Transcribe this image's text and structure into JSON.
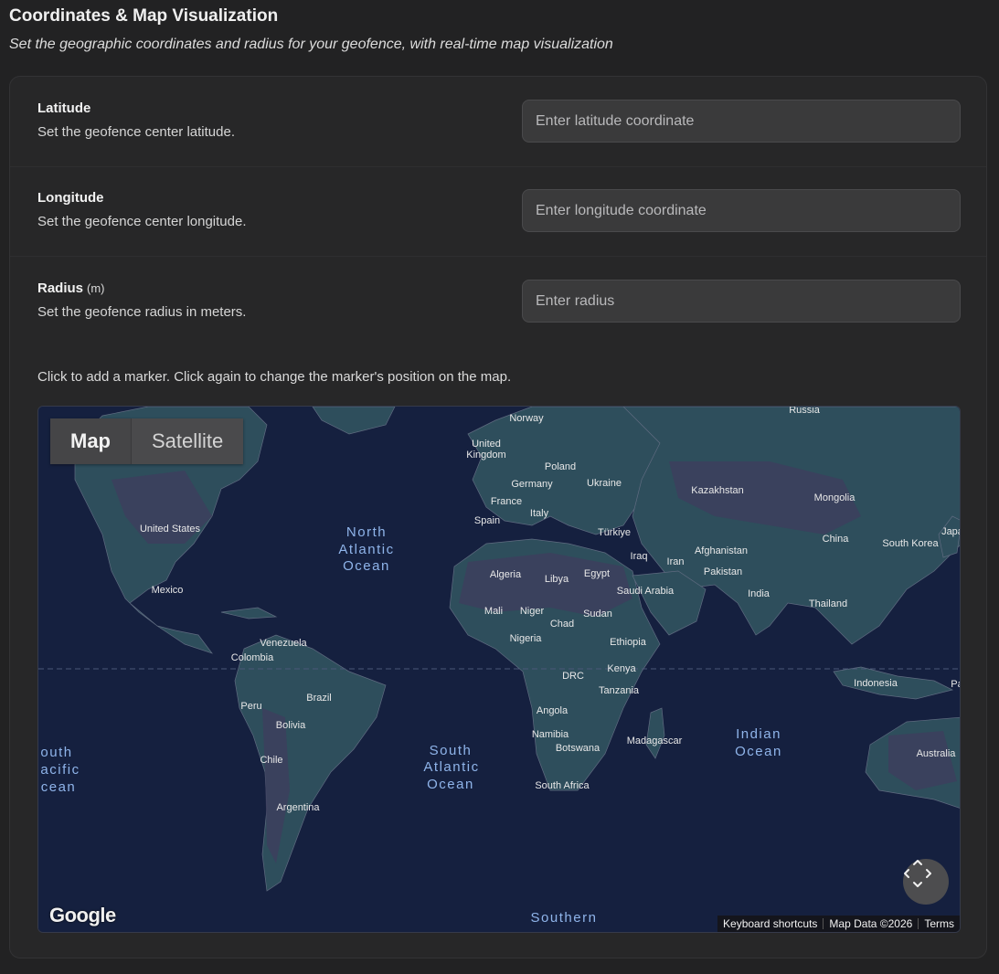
{
  "section": {
    "title": "Coordinates & Map Visualization",
    "subtitle": "Set the geographic coordinates and radius for your geofence, with real-time map visualization"
  },
  "fields": {
    "latitude": {
      "label": "Latitude",
      "description": "Set the geofence center latitude.",
      "placeholder": "Enter latitude coordinate",
      "value": ""
    },
    "longitude": {
      "label": "Longitude",
      "description": "Set the geofence center longitude.",
      "placeholder": "Enter longitude coordinate",
      "value": ""
    },
    "radius": {
      "label": "Radius",
      "unit": "(m)",
      "description": "Set the geofence radius in meters.",
      "placeholder": "Enter radius",
      "value": ""
    }
  },
  "map": {
    "hint": "Click to add a marker. Click again to change the marker's position on the map.",
    "type_buttons": {
      "map": "Map",
      "satellite": "Satellite",
      "selected": "Map"
    },
    "logo": "Google",
    "attribution": {
      "shortcuts": "Keyboard shortcuts",
      "data": "Map Data ©2026",
      "terms": "Terms"
    },
    "oceans": {
      "north_atlantic": [
        "North",
        "Atlantic",
        "Ocean"
      ],
      "south_atlantic": [
        "South",
        "Atlantic",
        "Ocean"
      ],
      "indian": [
        "Indian",
        "Ocean"
      ],
      "south_pacific": [
        "outh",
        "acific",
        "cean"
      ],
      "southern": "Southern"
    },
    "countries": {
      "russia": "Russia",
      "norway": "Norway",
      "uk": "United Kingdom",
      "poland": "Poland",
      "germany": "Germany",
      "ukraine": "Ukraine",
      "france": "France",
      "spain": "Spain",
      "italy": "Italy",
      "turkiye": "Türkiye",
      "kazakhstan": "Kazakhstan",
      "mongolia": "Mongolia",
      "china": "China",
      "japan": "Japa",
      "south_korea": "South Korea",
      "afghanistan": "Afghanistan",
      "iraq": "Iraq",
      "iran": "Iran",
      "pakistan": "Pakistan",
      "india": "India",
      "thailand": "Thailand",
      "saudi_arabia": "Saudi Arabia",
      "egypt": "Egypt",
      "libya": "Libya",
      "algeria": "Algeria",
      "mali": "Mali",
      "niger": "Niger",
      "chad": "Chad",
      "sudan": "Sudan",
      "nigeria": "Nigeria",
      "ethiopia": "Ethiopia",
      "kenya": "Kenya",
      "drc": "DRC",
      "tanzania": "Tanzania",
      "angola": "Angola",
      "namibia": "Namibia",
      "botswana": "Botswana",
      "madagascar": "Madagascar",
      "south_africa": "South Africa",
      "indonesia": "Indonesia",
      "australia": "Australia",
      "united_states": "United States",
      "mexico": "Mexico",
      "venezuela": "Venezuela",
      "colombia": "Colombia",
      "brazil": "Brazil",
      "peru": "Peru",
      "bolivia": "Bolivia",
      "chile": "Chile",
      "argentina": "Argentina",
      "papua": "Pa"
    }
  }
}
